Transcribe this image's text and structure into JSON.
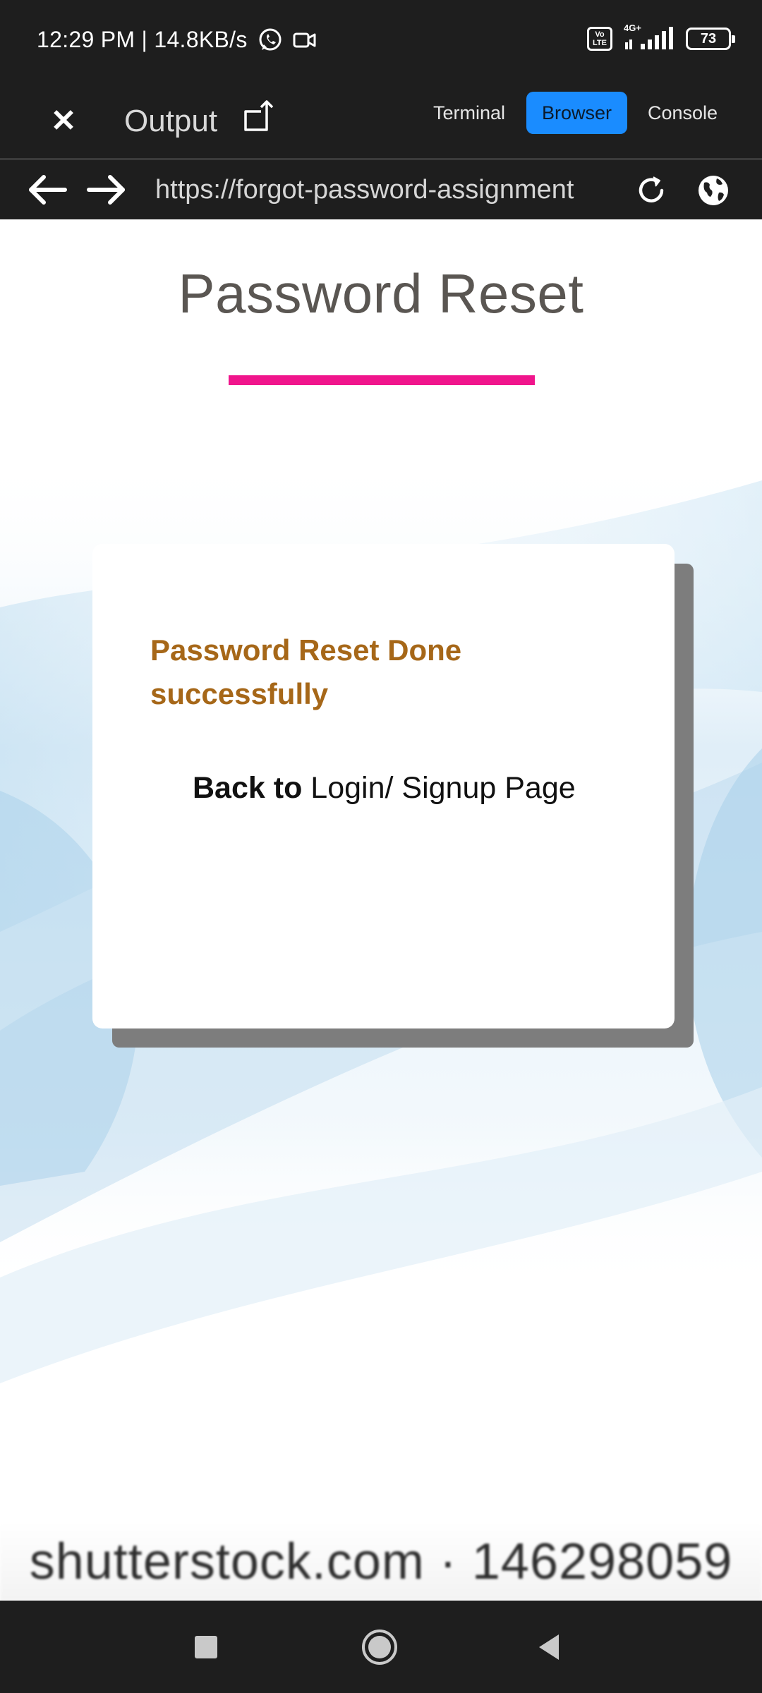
{
  "status_bar": {
    "time_speed": "12:29 PM | 14.8KB/s",
    "volte_label": "Vo LTE",
    "network_label": "4G+",
    "battery_level": "73",
    "icons": [
      "whatsapp-icon",
      "video-call-icon",
      "volte-icon",
      "signal-icon",
      "battery-icon"
    ]
  },
  "output_header": {
    "title": "Output",
    "close_label": "✕",
    "tabs": [
      {
        "label": "Terminal",
        "active": false
      },
      {
        "label": "Browser",
        "active": true
      },
      {
        "label": "Console",
        "active": false
      }
    ],
    "accent_color": "#1a8cff"
  },
  "url_bar": {
    "url": "https://forgot-password-assignment"
  },
  "page": {
    "title": "Password Reset",
    "underline_color": "#f0158c",
    "success_message": "Password Reset Done successfully",
    "success_color": "#a66718",
    "back_prefix": "Back to",
    "back_link": "Login/ Signup Page"
  },
  "watermark": {
    "text": "shutterstock.com · 146298059"
  },
  "nav_bar": {
    "buttons": [
      "recents",
      "home",
      "back"
    ]
  }
}
